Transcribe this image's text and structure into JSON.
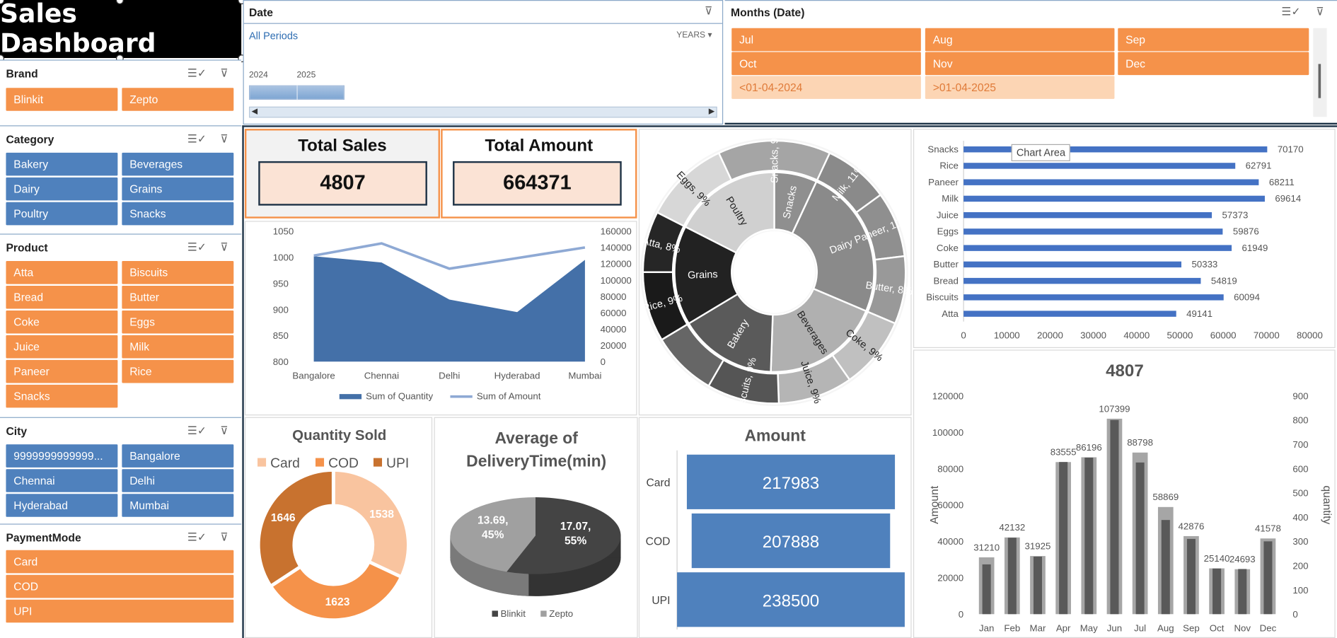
{
  "dashboard_title": "Sales Dashboard",
  "date_slicer": {
    "title": "Date",
    "periods": "All Periods",
    "level": "YEARS",
    "years": [
      "2024",
      "2025"
    ]
  },
  "months_slicer": {
    "title": "Months (Date)",
    "items": [
      "Jul",
      "Aug",
      "Sep",
      "Oct",
      "Nov",
      "Dec"
    ],
    "disabled_items": [
      "<01-04-2024",
      ">01-04-2025"
    ]
  },
  "brand_slicer": {
    "title": "Brand",
    "items": [
      "Blinkit",
      "Zepto"
    ]
  },
  "category_slicer": {
    "title": "Category",
    "items": [
      "Bakery",
      "Beverages",
      "Dairy",
      "Grains",
      "Poultry",
      "Snacks"
    ]
  },
  "product_slicer": {
    "title": "Product",
    "items": [
      "Atta",
      "Biscuits",
      "Bread",
      "Butter",
      "Coke",
      "Eggs",
      "Juice",
      "Milk",
      "Paneer",
      "Rice",
      "Snacks"
    ]
  },
  "city_slicer": {
    "title": "City",
    "items": [
      "9999999999999...",
      "Bangalore",
      "Chennai",
      "Delhi",
      "Hyderabad",
      "Mumbai"
    ]
  },
  "payment_slicer": {
    "title": "PaymentMode",
    "items": [
      "Card",
      "COD",
      "UPI"
    ]
  },
  "kpis": {
    "total_sales_label": "Total Sales",
    "total_sales": "4807",
    "total_amount_label": "Total Amount",
    "total_amount": "664371"
  },
  "tooltip": "Chart Area",
  "colors": {
    "orange": "#f5924a",
    "blue": "#4f81bd",
    "pale_orange": "#fcd5b4",
    "dark": "#1f3448"
  },
  "chart_data": [
    {
      "type": "area",
      "id": "city-chart",
      "categories": [
        "Bangalore",
        "Chennai",
        "Delhi",
        "Hyderabad",
        "Mumbai"
      ],
      "series": [
        {
          "name": "Sum of Quantity",
          "type": "area",
          "values": [
            1002,
            990,
            919,
            895,
            995
          ]
        },
        {
          "name": "Sum of Amount",
          "type": "line",
          "axis": "secondary",
          "values": [
            130000,
            145000,
            114000,
            127000,
            140000
          ]
        }
      ],
      "ylim": [
        800,
        1050
      ],
      "yticks": [
        800,
        850,
        900,
        950,
        1000,
        1050
      ],
      "y2lim": [
        0,
        160000
      ],
      "y2ticks": [
        0,
        20000,
        40000,
        60000,
        80000,
        100000,
        120000,
        140000,
        160000
      ]
    },
    {
      "type": "pie",
      "id": "sunburst",
      "inner": [
        "Snacks",
        "Dairy",
        "Beverages",
        "Bakery",
        "Grains",
        "Poultry"
      ],
      "outer": [
        "Snacks, 9%",
        "Milk, 11%",
        "Paneer, 10%",
        "Butter, 8%",
        "Coke, 9%",
        "Juice, 9%",
        "Biscuits, 9%",
        "",
        "Rice, 9%",
        "Atta, 8%",
        "Eggs, 9%"
      ]
    },
    {
      "type": "bar",
      "id": "product-bar",
      "categories": [
        "Snacks",
        "Rice",
        "Paneer",
        "Milk",
        "Juice",
        "Eggs",
        "Coke",
        "Butter",
        "Bread",
        "Biscuits",
        "Atta"
      ],
      "values": [
        70170,
        62791,
        68211,
        69614,
        57373,
        59876,
        61949,
        50333,
        54819,
        60094,
        49141
      ],
      "xlim": [
        0,
        80000
      ],
      "xticks": [
        0,
        10000,
        20000,
        30000,
        40000,
        50000,
        60000,
        70000,
        80000
      ]
    },
    {
      "type": "pie",
      "id": "quantity-donut",
      "title": "Quantity Sold",
      "categories": [
        "Card",
        "COD",
        "UPI"
      ],
      "values": [
        1538,
        1623,
        1646
      ]
    },
    {
      "type": "pie",
      "id": "delivery-pie",
      "title": "Average of DeliveryTime(min)",
      "categories": [
        "Blinkit",
        "Zepto"
      ],
      "values": [
        17.07,
        13.69
      ],
      "labels": [
        "17.07, 55%",
        "13.69, 45%"
      ]
    },
    {
      "type": "bar",
      "id": "amount-bar",
      "title": "Amount",
      "categories": [
        "Card",
        "COD",
        "UPI"
      ],
      "values": [
        217983,
        207888,
        238500
      ]
    },
    {
      "type": "bar",
      "id": "monthly-bar",
      "title": "4807",
      "ylabel": "Amount",
      "y2label": "quantity",
      "categories": [
        "Jan",
        "Feb",
        "Mar",
        "Apr",
        "May",
        "Jun",
        "Jul",
        "Aug",
        "Sep",
        "Oct",
        "Nov",
        "Dec"
      ],
      "series": [
        {
          "name": "Amount",
          "values": [
            31210,
            42132,
            31925,
            83555,
            86196,
            107399,
            88798,
            58869,
            42876,
            25140,
            24693,
            41578
          ]
        },
        {
          "name": "quantity",
          "axis": "secondary",
          "values": [
            205,
            315,
            237,
            627,
            645,
            800,
            625,
            388,
            310,
            188,
            186,
            300
          ]
        }
      ],
      "ylim": [
        0,
        120000
      ],
      "yticks": [
        0,
        20000,
        40000,
        60000,
        80000,
        100000,
        120000
      ],
      "y2lim": [
        0,
        900
      ],
      "y2ticks": [
        0,
        100,
        200,
        300,
        400,
        500,
        600,
        700,
        800,
        900
      ]
    }
  ]
}
